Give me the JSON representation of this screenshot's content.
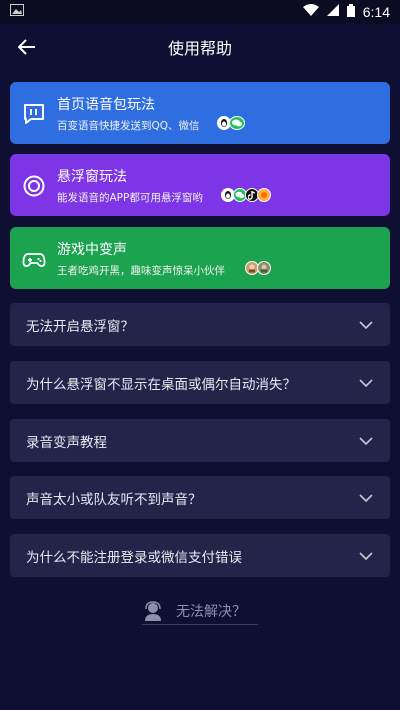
{
  "status_bar": {
    "time": "6:14"
  },
  "header": {
    "title": "使用帮助"
  },
  "cards": [
    {
      "title": "首页语音包玩法",
      "subtitle": "百变语音快捷发送到QQ、微信",
      "color": "#2f6ee0",
      "icon": "chat-bubble-icon"
    },
    {
      "title": "悬浮窗玩法",
      "subtitle": "能发语音的APP都可用悬浮窗哟",
      "color": "#7d35e6",
      "icon": "floating-circle-icon"
    },
    {
      "title": "游戏中变声",
      "subtitle": "王者吃鸡开黑，趣味变声惊呆小伙伴",
      "color": "#1ca350",
      "icon": "gamepad-icon"
    }
  ],
  "faq": [
    {
      "question": "无法开启悬浮窗？"
    },
    {
      "question": "为什么悬浮窗不显示在桌面或偶尔自动消失？"
    },
    {
      "question": "录音变声教程"
    },
    {
      "question": "声音太小或队友听不到声音？"
    },
    {
      "question": "为什么不能注册登录或微信支付错误"
    }
  ],
  "footer": {
    "help_label": "无法解决？"
  }
}
